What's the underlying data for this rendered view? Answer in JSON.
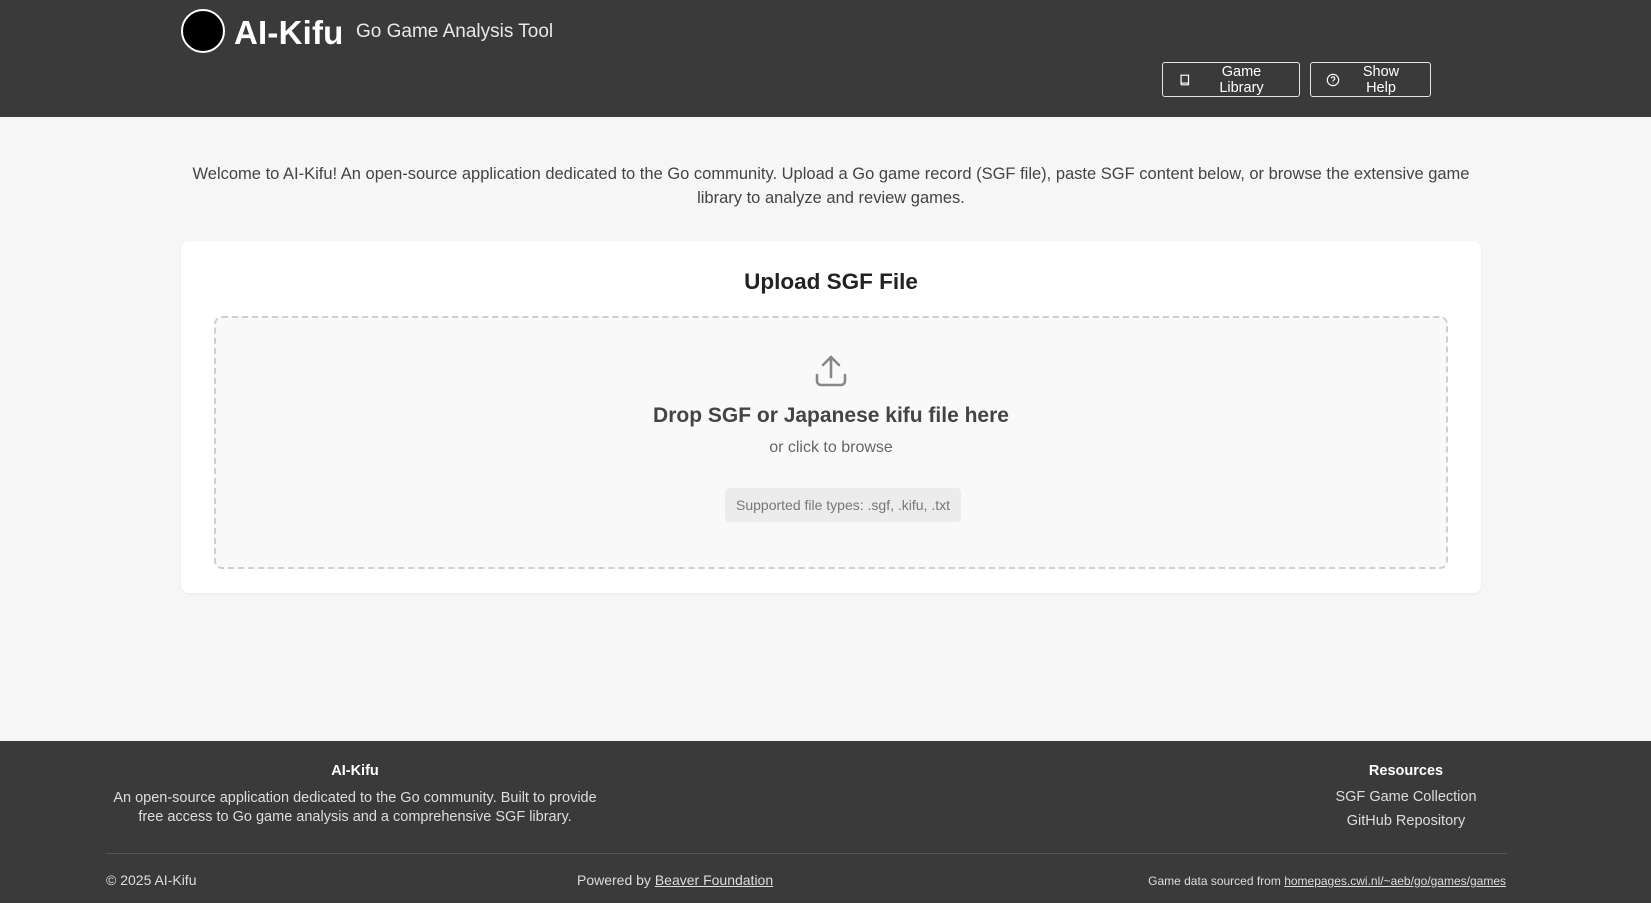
{
  "header": {
    "title": "AI-Kifu",
    "subtitle": "Go Game Analysis Tool",
    "game_library_label": "Game Library",
    "show_help_label": "Show Help"
  },
  "main": {
    "welcome_text": "Welcome to AI-Kifu! An open-source application dedicated to the Go community. Upload a Go game record (SGF file), paste SGF content below, or browse the extensive game library to analyze and review games.",
    "upload_title": "Upload SGF File",
    "drop_title": "Drop SGF or Japanese kifu file here",
    "drop_subtitle": "or click to browse",
    "supported_types": "Supported file types: .sgf, .kifu, .txt"
  },
  "footer": {
    "about_heading": "AI-Kifu",
    "about_text": "An open-source application dedicated to the Go community. Built to provide free access to Go game analysis and a comprehensive SGF library.",
    "resources_heading": "Resources",
    "resources_links": [
      "SGF Game Collection",
      "GitHub Repository"
    ],
    "copyright": "© 2025 AI-Kifu",
    "powered_prefix": "Powered by ",
    "powered_link": "Beaver Foundation",
    "sourced_prefix": "Game data sourced from ",
    "sourced_link": "homepages.cwi.nl/~aeb/go/games/games"
  },
  "icons": {
    "logo": "go-stone-logo",
    "library": "book-icon",
    "help": "help-circle-icon",
    "upload": "upload-icon"
  },
  "colors": {
    "header_bg": "#3a3a3a",
    "page_bg": "#f6f6f6",
    "card_bg": "#ffffff"
  }
}
